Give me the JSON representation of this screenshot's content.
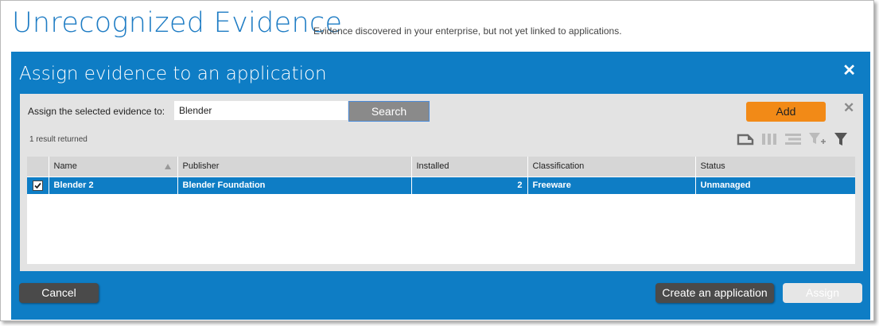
{
  "page": {
    "title": "Unrecognized Evidence",
    "subtitle": "Evidence discovered in your enterprise, but not yet linked to applications."
  },
  "dialog": {
    "title": "Assign evidence to an application",
    "close_icon": "close-icon",
    "assign_label": "Assign the selected evidence to:",
    "search_value": "Blender",
    "search_button": "Search",
    "add_button": "Add",
    "result_count": "1 result returned",
    "toolbar_icons": [
      "export-icon",
      "columns-icon",
      "group-icon",
      "add-filter-icon",
      "filter-icon"
    ],
    "table": {
      "columns": [
        "Name",
        "Publisher",
        "Installed",
        "Classification",
        "Status"
      ],
      "rows": [
        {
          "checked": true,
          "name": "Blender 2",
          "publisher": "Blender Foundation",
          "installed": "2",
          "classification": "Freeware",
          "status": "Unmanaged"
        }
      ]
    },
    "footer": {
      "cancel": "Cancel",
      "create": "Create an application",
      "assign": "Assign"
    }
  },
  "colors": {
    "accent_blue": "#0e7dc5",
    "title_blue": "#1e7cc4",
    "add_orange": "#f28a17",
    "dark_button": "#4a4a4a"
  }
}
